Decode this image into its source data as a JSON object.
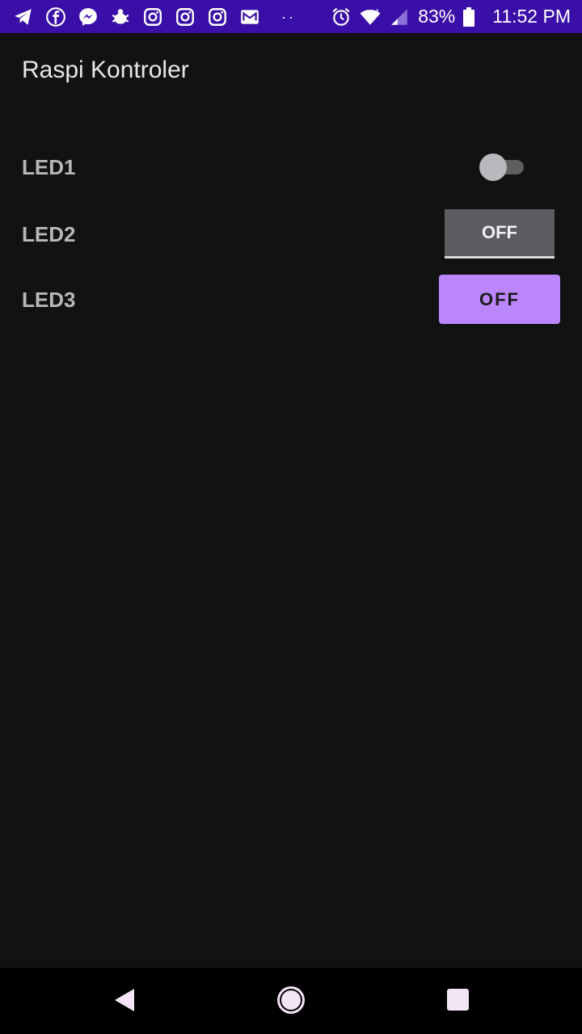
{
  "status_bar": {
    "battery": "83%",
    "time": "11:52 PM",
    "dots": "··",
    "background": "#3a0fa8",
    "icons": [
      "telegram-icon",
      "facebook-icon",
      "messenger-icon",
      "bug-icon",
      "instagram-icon",
      "instagram-icon",
      "instagram-icon",
      "mail-icon",
      "alarm-icon",
      "wifi-icon",
      "signal-icon",
      "battery-icon"
    ]
  },
  "app": {
    "title": "Raspi Kontroler",
    "background": "#121212",
    "accent": "#bb86fc"
  },
  "rows": [
    {
      "label": "LED1",
      "control": "switch",
      "state": "off"
    },
    {
      "label": "LED2",
      "control": "toggle-button",
      "text": "OFF"
    },
    {
      "label": "LED3",
      "control": "button",
      "text": "OFF"
    }
  ],
  "nav_bar": {
    "icons": [
      "back-icon",
      "home-icon",
      "recents-icon"
    ]
  }
}
